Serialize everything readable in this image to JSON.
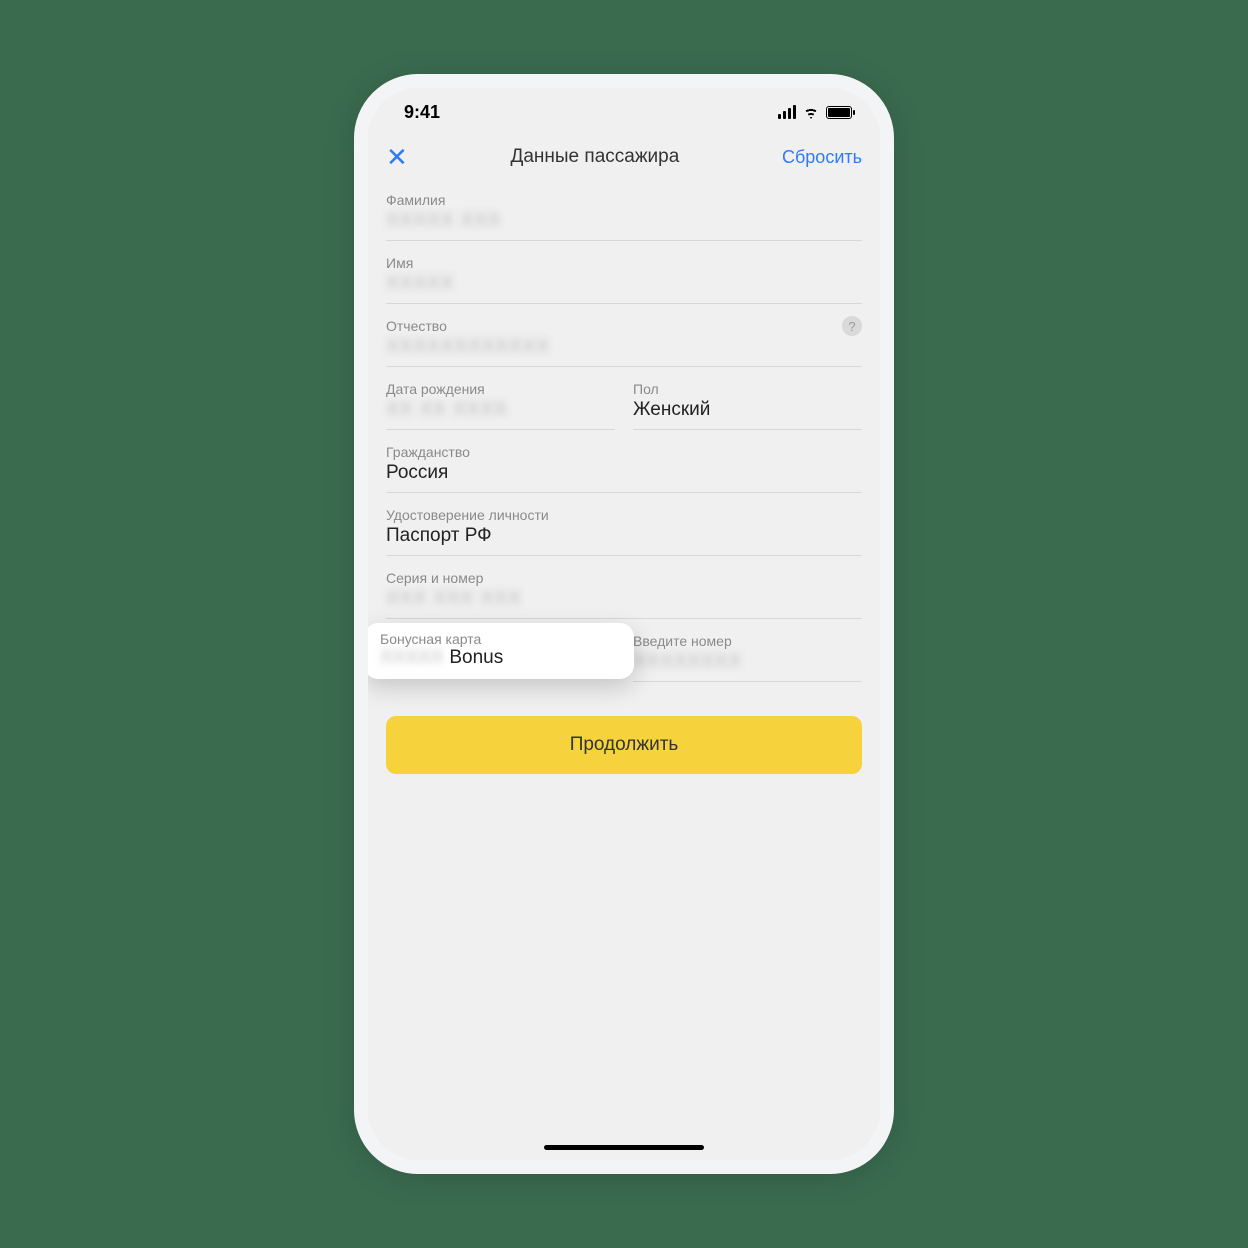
{
  "status": {
    "time": "9:41"
  },
  "nav": {
    "title": "Данные пассажира",
    "reset": "Сбросить"
  },
  "fields": {
    "surname": {
      "label": "Фамилия"
    },
    "name": {
      "label": "Имя"
    },
    "patronymic": {
      "label": "Отчество"
    },
    "dob": {
      "label": "Дата рождения"
    },
    "gender": {
      "label": "Пол",
      "value": "Женский"
    },
    "citizenship": {
      "label": "Гражданство",
      "value": "Россия"
    },
    "id_doc": {
      "label": "Удостоверение личности",
      "value": "Паспорт РФ"
    },
    "doc_number": {
      "label": "Серия и номер"
    },
    "bonus_card": {
      "label": "Бонусная карта",
      "value_suffix": "Bonus"
    },
    "enter_number": {
      "label": "Введите номер"
    }
  },
  "button": {
    "continue": "Продолжить"
  }
}
